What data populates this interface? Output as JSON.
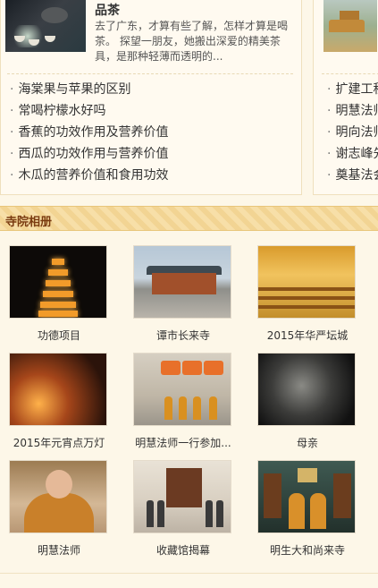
{
  "tea_article": {
    "title": "品茶",
    "summary": "去了广东，才算有些了解，怎样才算是喝茶。 探望一朋友，她搬出深爱的精美茶具，是那种轻薄而透明的..."
  },
  "left_links": [
    "海棠果与苹果的区别",
    "常喝柠檬水好吗",
    "香蕉的功效作用及营养价值",
    "西瓜的功效作用与营养价值",
    "木瓜的营养价值和食用功效"
  ],
  "right_links": [
    "扩建工程",
    "明慧法师",
    "明向法师",
    "谢志峰先",
    "奠基法会"
  ],
  "bullet": "·",
  "gallery": {
    "title": "寺院相册",
    "items": [
      {
        "caption": "功德项目",
        "photo": "pagoda-night"
      },
      {
        "caption": "谭市长来寺",
        "photo": "temple-hall"
      },
      {
        "caption": "2015年华严坛城",
        "photo": "golden-hall"
      },
      {
        "caption": "2015年元宵点万灯",
        "photo": "lantern-lighting"
      },
      {
        "caption": "明慧法师一行参加...",
        "photo": "monk-procession"
      },
      {
        "caption": "母亲",
        "photo": "mother-portrait"
      },
      {
        "caption": "明慧法师",
        "photo": "master-portrait"
      },
      {
        "caption": "收藏馆揭幕",
        "photo": "museum-unveiling"
      },
      {
        "caption": "明生大和尚来寺",
        "photo": "monk-visit"
      }
    ]
  },
  "colors": {
    "background": "#fdf7e8",
    "section_bar": "#f7dfa8",
    "section_title": "#7a3b10"
  }
}
